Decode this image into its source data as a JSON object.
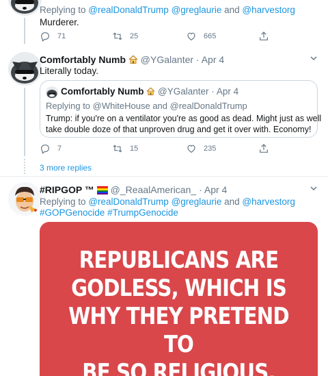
{
  "tweet1": {
    "reply_prefix": "Replying to",
    "reply_mentions": [
      "@realDonaldTrump",
      "@greglaurie"
    ],
    "reply_and": "and",
    "reply_last": "@harvestorg",
    "text": "Murderer.",
    "stats": {
      "replies": "71",
      "retweets": "25",
      "likes": "665"
    }
  },
  "tweet2": {
    "display_name": "Comfortably Numb",
    "handle": "@YGalanter",
    "dot": "·",
    "date": "Apr 4",
    "text": "Literally today.",
    "quote": {
      "display_name": "Comfortably Numb",
      "handle": "@YGalanter",
      "dot": "·",
      "date": "Apr 4",
      "reply_prefix": "Replying to",
      "reply_first": "@WhiteHouse",
      "reply_and": "and",
      "reply_last": "@realDonaldTrump",
      "text_line1": "Trump: if you're on a ventilator you're as good as dead. Might just as well",
      "text_line2": "take double doze of that unproven drug and get it over with. Economy!"
    },
    "stats": {
      "replies": "7",
      "retweets": "15",
      "likes": "235"
    },
    "more_replies": "3 more replies"
  },
  "tweet3": {
    "display_name": "#RIPGOP ™",
    "handle": "@_ReaalAmerican_",
    "dot": "·",
    "date": "Apr 4",
    "reply_prefix": "Replying to",
    "reply_mentions": [
      "@realDonaldTrump",
      "@greglaurie"
    ],
    "reply_and": "and",
    "reply_last": "@harvestorg",
    "hashtag1": "#GOPGenocide",
    "hashtag2": "#TrumpGenocide",
    "image_text": [
      "REPUBLICANS ARE",
      "GODLESS, WHICH IS",
      "WHY THEY PRETEND TO",
      "BE SO RELIGIOUS."
    ]
  },
  "colors": {
    "link": "#1b95e0",
    "muted": "#657786",
    "image_background": "#d9474b"
  }
}
